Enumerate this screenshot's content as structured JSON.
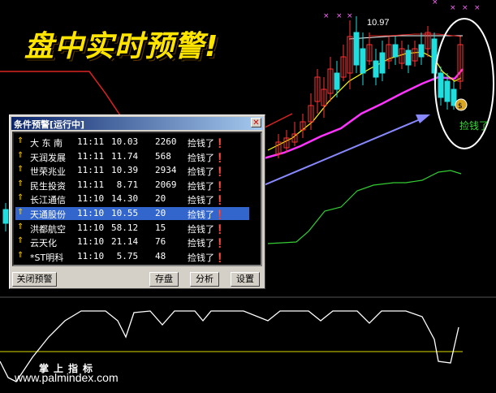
{
  "banner": {
    "title": "盘中实时预警!"
  },
  "chart": {
    "price_label": "10.97",
    "money_label": "捡钱了",
    "indicator_label": "掌上指标",
    "site": "www.palmindex.com"
  },
  "dialog": {
    "title": "条件预警[运行中]",
    "close_glyph": "✕",
    "rows": [
      {
        "name": "大 东 南",
        "time": "11:11",
        "price": "10.03",
        "volume": "2260",
        "message": "捡钱了❗"
      },
      {
        "name": "天润发展",
        "time": "11:11",
        "price": "11.74",
        "volume": "568",
        "message": "捡钱了❗"
      },
      {
        "name": "世荣兆业",
        "time": "11:11",
        "price": "10.39",
        "volume": "2934",
        "message": "捡钱了❗"
      },
      {
        "name": "民生投资",
        "time": "11:11",
        "price": " 8.71",
        "volume": "2069",
        "message": "捡钱了❗"
      },
      {
        "name": "长江通信",
        "time": "11:10",
        "price": "14.30",
        "volume": "20",
        "message": "捡钱了❗"
      },
      {
        "name": "天通股份",
        "time": "11:10",
        "price": "10.55",
        "volume": "20",
        "message": "捡钱了❗",
        "selected": true
      },
      {
        "name": "洪都航空",
        "time": "11:10",
        "price": "58.12",
        "volume": "15",
        "message": "捡钱了❗"
      },
      {
        "name": "云天化",
        "time": "11:10",
        "price": "21.14",
        "volume": "76",
        "message": "捡钱了❗"
      },
      {
        "name": "*ST明科",
        "time": "11:10",
        "price": " 5.75",
        "volume": "48",
        "message": "捡钱了❗"
      }
    ],
    "buttons": {
      "close_alert": "关闭预警",
      "save": "存盘",
      "analyze": "分析",
      "settings": "设置"
    }
  },
  "colors": {
    "accent_title": "#ffe400",
    "dialog_bg": "#d4d0c8",
    "titlebar": "#0a246a",
    "selection": "#3366cc",
    "candle_up": "#ff3333",
    "candle_down": "#22dddd",
    "ma_magenta": "#ff33ff",
    "ma_yellow": "#ffff00",
    "line_green": "#33cc33"
  }
}
